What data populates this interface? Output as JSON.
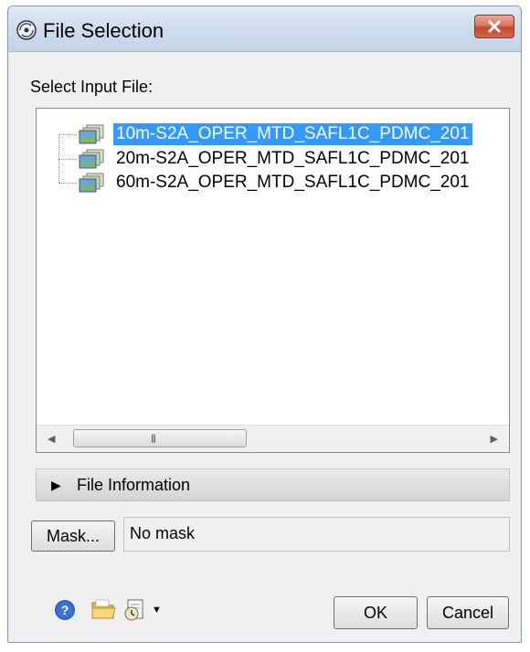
{
  "window": {
    "title": "File Selection",
    "icons": {
      "app": "dialog-icon",
      "close": "close-icon"
    }
  },
  "prompt": "Select Input File:",
  "files": [
    {
      "label": "10m-S2A_OPER_MTD_SAFL1C_PDMC_201",
      "selected": true
    },
    {
      "label": "20m-S2A_OPER_MTD_SAFL1C_PDMC_201",
      "selected": false
    },
    {
      "label": "60m-S2A_OPER_MTD_SAFL1C_PDMC_201",
      "selected": false
    }
  ],
  "file_info": {
    "label": "File Information",
    "expanded": false
  },
  "mask": {
    "button_label": "Mask...",
    "value": "No mask"
  },
  "footer": {
    "icons": [
      "help-icon",
      "folder-icon",
      "history-icon"
    ],
    "ok_label": "OK",
    "cancel_label": "Cancel"
  },
  "colors": {
    "selection": "#3399ff",
    "close_button": "#c2472d",
    "help_icon": "#2f5fc0"
  }
}
